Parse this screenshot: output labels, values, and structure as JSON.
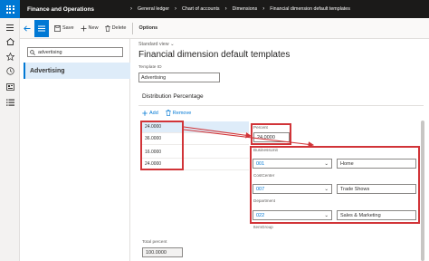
{
  "app": {
    "title": "Finance and Operations"
  },
  "breadcrumbs": [
    "General ledger",
    "Chart of accounts",
    "Dimensions",
    "Financial dimension default templates"
  ],
  "actions": {
    "save": "Save",
    "new": "New",
    "delete": "Delete",
    "options": "Options"
  },
  "list": {
    "search_value": "advertising",
    "items": [
      "Advertising"
    ]
  },
  "view": {
    "label": "Standard view"
  },
  "page": {
    "title": "Financial dimension default templates",
    "template_id_label": "Template ID",
    "template_id_value": "Advertising"
  },
  "section": {
    "title": "Distribution Percentage",
    "add": "Add",
    "remove": "Remove"
  },
  "grid": {
    "rows": [
      "24.0000",
      "36.0000",
      "16.0000",
      "24.0000"
    ]
  },
  "total": {
    "label": "Total percent",
    "value": "100.0000"
  },
  "detail": {
    "percent_label": "Percent",
    "percent_value": "24.0000",
    "business_unit_label": "BusinessUnit",
    "business_unit_value": "001",
    "business_unit_desc": "Home",
    "cost_center_label": "CostCenter",
    "cost_center_value": "007",
    "cost_center_desc": "Trade Shows",
    "department_label": "Department",
    "department_value": "022",
    "department_desc": "Sales & Marketing",
    "item_group_label": "ItemGroup"
  },
  "colors": {
    "accent": "#0078d4",
    "annotation": "#d13438",
    "topbar": "#1b1a19",
    "selection": "#deecf9"
  },
  "icons": [
    "waffle-icon",
    "home-icon",
    "star-icon",
    "clock-icon",
    "workspace-icon",
    "list-icon",
    "back-icon",
    "hamburger-icon",
    "save-icon",
    "plus-icon",
    "delete-icon",
    "search-icon",
    "chevron-down-icon"
  ]
}
